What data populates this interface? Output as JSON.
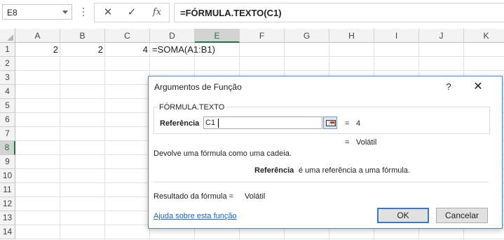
{
  "formula_bar": {
    "name_box": "E8",
    "cancel_icon": "✕",
    "enter_icon": "✓",
    "fx_label": "fx",
    "formula": "=FÓRMULA.TEXTO(C1)"
  },
  "grid": {
    "columns": [
      "A",
      "B",
      "C",
      "D",
      "E",
      "F",
      "G",
      "H",
      "I",
      "J",
      "K"
    ],
    "rows": [
      "1",
      "2",
      "3",
      "4",
      "5",
      "6",
      "7",
      "8",
      "9",
      "10",
      "11",
      "12",
      "13",
      "14"
    ],
    "selected_column": "E",
    "selected_row": "8",
    "cells": {
      "A1": "2",
      "B1": "2",
      "C1": "4",
      "D1": "=SOMA(A1:B1)"
    }
  },
  "dialog": {
    "title": "Argumentos de Função",
    "help_label": "?",
    "close_label": "✕",
    "function_name": "FÓRMULA.TEXTO",
    "argument_label": "Referência",
    "argument_value": "C1",
    "argument_eq": "=",
    "argument_result": "4",
    "function_eq": "=",
    "function_result": "Volátil",
    "description": "Devolve uma fórmula como uma cadeia.",
    "arg_help_name": "Referência",
    "arg_help_text": "é uma referência a uma fórmula.",
    "result_label": "Resultado da fórmula =",
    "result_value": "Volátil",
    "help_link": "Ajuda sobre esta função",
    "ok_label": "OK",
    "cancel_label": "Cancelar"
  }
}
